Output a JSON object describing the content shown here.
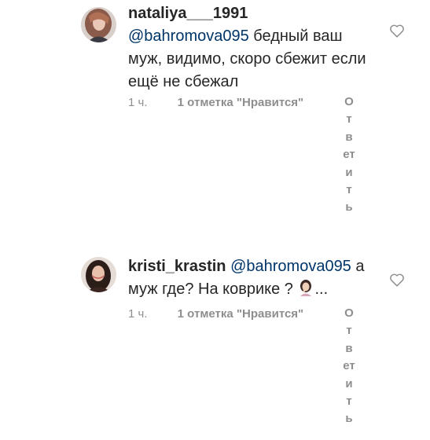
{
  "comments": [
    {
      "username": "nataliya___1991",
      "mention": "@bahromova095",
      "text": "бедный ваш муж, видимо, скоро сбежит если ещё не сбежал",
      "time": "1 ч.",
      "likes": "1 отметка \"Нравится\"",
      "reply": "Ответить"
    },
    {
      "username": "kristi_krastin",
      "mention": "@bahromova095",
      "text": "а муж где? На коврике ?",
      "suffix": "...",
      "emoji": "woman-facepalming-emoji",
      "time": "1 ч.",
      "likes": "1 отметка \"Нравится\"",
      "reply": "Ответить"
    }
  ],
  "icons": {
    "like": "heart-outline-icon"
  },
  "colors": {
    "mention": "#003569",
    "meta": "#8e8e8e",
    "text": "#262626"
  }
}
